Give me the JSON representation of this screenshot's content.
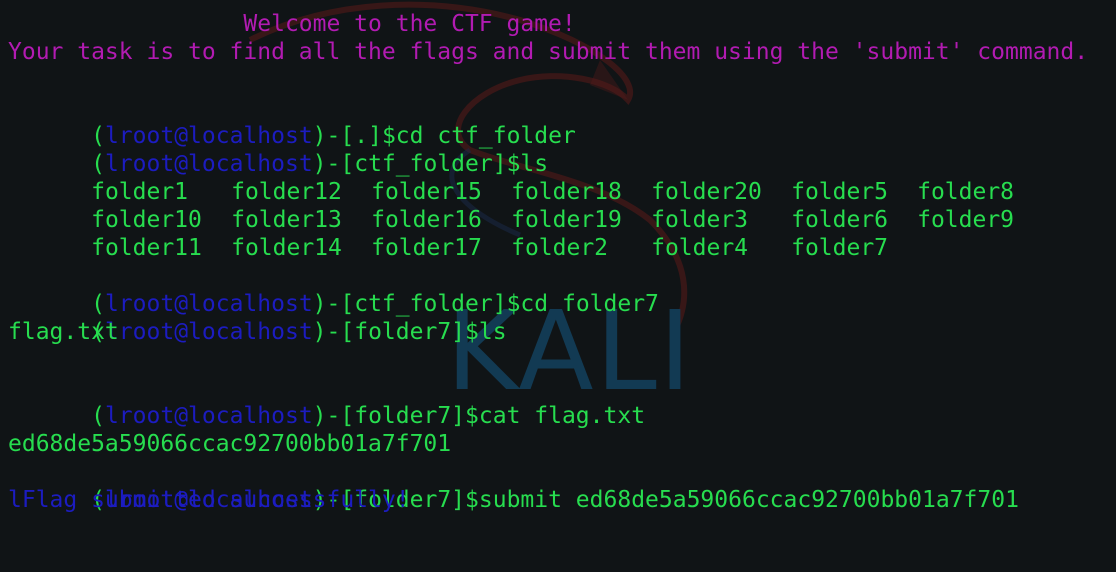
{
  "terminal": {
    "banner": {
      "welcome": "                 Welcome to the CTF game!",
      "task": "Your task is to find all the flags and submit them using the 'submit' command."
    },
    "prompt": {
      "user": "lroot@localhost",
      "open_paren": "(",
      "close_paren": ")",
      "dash_bracket": "-[",
      "close_bracket": "]"
    },
    "session": [
      {
        "dir": ".",
        "command": "$cd ctf_folder"
      },
      {
        "dir": "ctf_folder",
        "command": "$ls"
      },
      {
        "dir": "ctf_folder",
        "command": "$cd folder7"
      },
      {
        "dir": "folder7",
        "command": "$ls"
      },
      {
        "dir": "folder7",
        "command": "$cat flag.txt"
      },
      {
        "dir": "folder7",
        "command": "$submit ed68de5a59066ccac92700bb01a7f701"
      },
      {
        "dir": "folder7",
        "command": "$"
      }
    ],
    "ls_listing": [
      [
        "folder1",
        "folder12",
        "folder15",
        "folder18",
        "folder20",
        "folder5",
        "folder8"
      ],
      [
        "folder10",
        "folder13",
        "folder16",
        "folder19",
        "folder3",
        "folder6",
        "folder9"
      ],
      [
        "folder11",
        "folder14",
        "folder17",
        "folder2",
        "folder4",
        "folder7",
        ""
      ]
    ],
    "ls_folder7_output": "flag.txt",
    "flag_value": "ed68de5a59066ccac92700bb01a7f701",
    "submit_result": "lFlag submitted successfully!",
    "cursor": "_"
  },
  "watermark": {
    "text": "KALI",
    "color": "#123a53",
    "icon": "kali-dragon-icon"
  },
  "colors": {
    "background": "#101416",
    "prompt_green": "#27dd4f",
    "user_blue": "#1c1cc0",
    "banner_magenta": "#b21bb2"
  }
}
